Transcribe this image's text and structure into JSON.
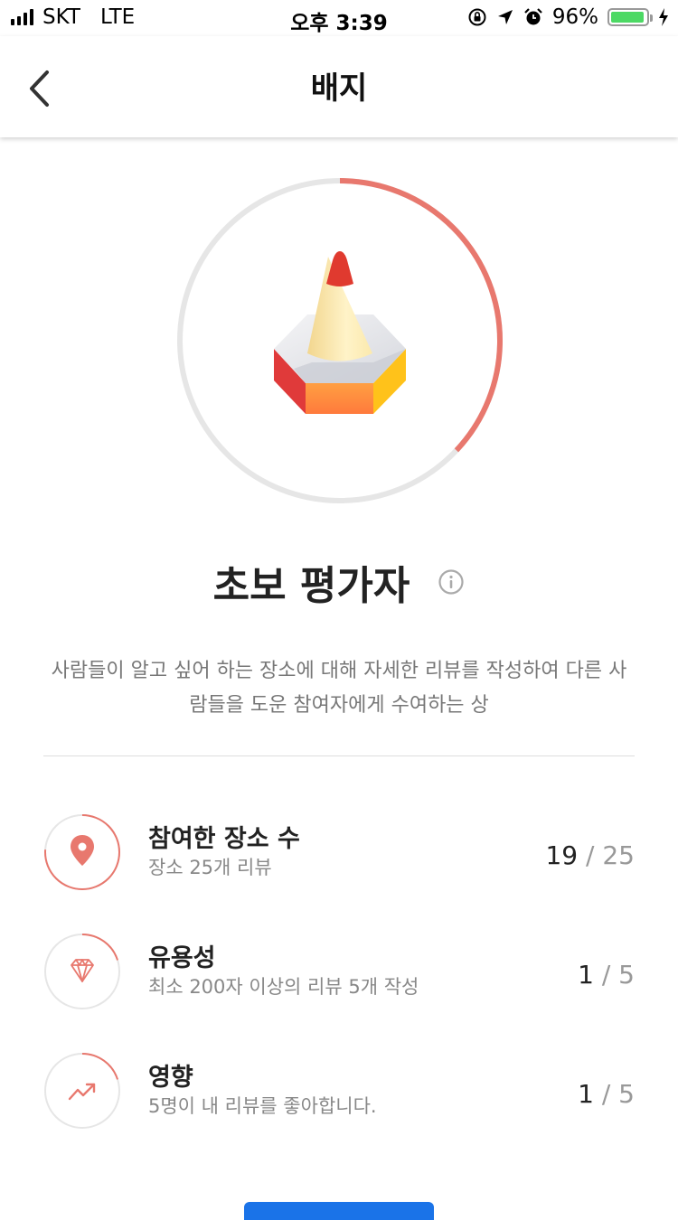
{
  "status_bar": {
    "carrier": "SKT",
    "network": "LTE",
    "time": "오후 3:39",
    "battery_percent": "96%",
    "battery_level": 0.96,
    "icons": [
      "orientation-lock-icon",
      "location-arrow-icon",
      "alarm-icon",
      "battery-icon",
      "charging-bolt-icon"
    ]
  },
  "nav": {
    "title": "배지",
    "back_icon": "chevron-left-icon"
  },
  "badge": {
    "name": "초보 평가자",
    "progress_fraction": 0.37,
    "accent_color": "#e8786e",
    "track_color": "#e6e6e6",
    "image": "pencil-hexagon-badge",
    "description": "사람들이 알고 싶어 하는 장소에 대해 자세한 리뷰를 작성하여 다른 사람들을 도운 참여자에게 수여하는 상"
  },
  "requirements": [
    {
      "icon": "map-pin-icon",
      "title": "참여한 장소 수",
      "subtitle": "장소 25개 리뷰",
      "current": "19",
      "separator": "/",
      "total": "25",
      "progress_fraction": 0.76
    },
    {
      "icon": "diamond-icon",
      "title": "유용성",
      "subtitle": "최소 200자 이상의 리뷰 5개 작성",
      "current": "1",
      "separator": "/",
      "total": "5",
      "progress_fraction": 0.2
    },
    {
      "icon": "trending-up-icon",
      "title": "영향",
      "subtitle": "5명이 내 리뷰를 좋아합니다.",
      "current": "1",
      "separator": "/",
      "total": "5",
      "progress_fraction": 0.2
    }
  ]
}
